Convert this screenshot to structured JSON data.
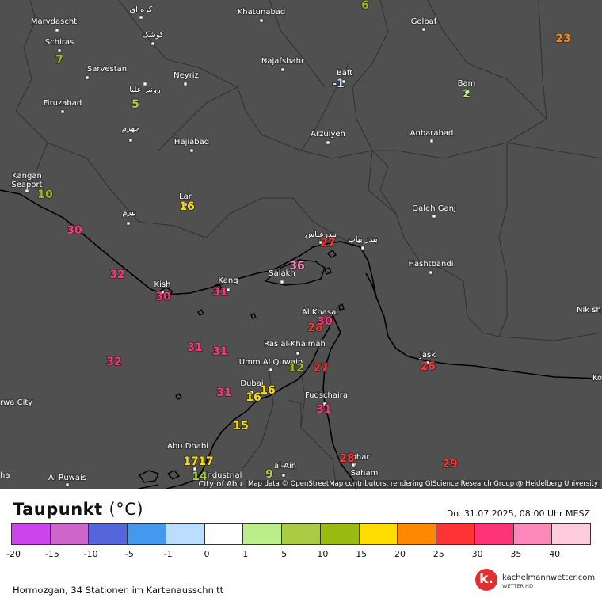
{
  "title": {
    "text": "Taupunkt",
    "unit": "(°C)"
  },
  "datetime": "Do. 31.07.2025, 08:00 Uhr MESZ",
  "attribution": "Map data © OpenStreetMap contributors, rendering GIScience Research Group @ Heidelberg University",
  "station_count": "Hormozgan, 34 Stationen im Kartenausschnitt",
  "logo": {
    "name": "kachelmannwetter.com",
    "sub": "WETTER HD",
    "letter": "k."
  },
  "colors": {
    "map_background": "#505050",
    "border": "#333333",
    "coast": "#000000",
    "label_text": "#ffffff"
  },
  "scale": {
    "ticks": [
      "-20",
      "-15",
      "-10",
      "-5",
      "-1",
      "0",
      "1",
      "5",
      "10",
      "15",
      "20",
      "25",
      "30",
      "35",
      "40"
    ],
    "colors": [
      "#cc44ee",
      "#cc66cc",
      "#5566dd",
      "#4499ee",
      "#bbddff",
      "#ffffff",
      "#bbee88",
      "#aacc44",
      "#99bb11",
      "#ffdd00",
      "#ff8800",
      "#ff3333",
      "#ff3377",
      "#ff88bb",
      "#ffccdd"
    ]
  },
  "places": [
    {
      "name": "Marvdascht"
    },
    {
      "name": "کره ای"
    },
    {
      "name": "Khatunabad"
    },
    {
      "name": "Golbaf"
    },
    {
      "name": "Schiras"
    },
    {
      "name": "کوشک"
    },
    {
      "name": "Sarvestan"
    },
    {
      "name": "Neyriz"
    },
    {
      "name": "Najafshahr"
    },
    {
      "name": "Baft"
    },
    {
      "name": "Bam"
    },
    {
      "name": "رونیز علیا"
    },
    {
      "name": "Firuzabad"
    },
    {
      "name": "جهرم"
    },
    {
      "name": "Hajiabad"
    },
    {
      "name": "Arzuiyeh"
    },
    {
      "name": "Anbarabad"
    },
    {
      "name": "Kangan Seaport"
    },
    {
      "name": "Lar"
    },
    {
      "name": "بیرم"
    },
    {
      "name": "Qaleh Ganj"
    },
    {
      "name": "بندرعباس"
    },
    {
      "name": "بندر بیاب"
    },
    {
      "name": "Hashtbandi"
    },
    {
      "name": "Kish"
    },
    {
      "name": "Kang"
    },
    {
      "name": "Salakh"
    },
    {
      "name": "Al Khasal"
    },
    {
      "name": "Nik sh"
    },
    {
      "name": "Ras al-Khaimah"
    },
    {
      "name": "Jask"
    },
    {
      "name": "Umm Al Quwain"
    },
    {
      "name": "Dubai"
    },
    {
      "name": "Fudschaira"
    },
    {
      "name": "Ko"
    },
    {
      "name": "rwa City"
    },
    {
      "name": "Abu Dhabi"
    },
    {
      "name": "al-Ain"
    },
    {
      "name": "Sohar"
    },
    {
      "name": "Al Ruwais"
    },
    {
      "name": "Industrial City of Abu"
    },
    {
      "name": "Saham"
    },
    {
      "name": "ha"
    }
  ],
  "stations": [
    {
      "value": "6",
      "color": "#99bb11"
    },
    {
      "value": "23",
      "color": "#ff8800"
    },
    {
      "value": "7",
      "color": "#99bb11"
    },
    {
      "value": "-1",
      "color": "#bbddff"
    },
    {
      "value": "2",
      "color": "#bbee88"
    },
    {
      "value": "5",
      "color": "#aacc44"
    },
    {
      "value": "10",
      "color": "#99bb11"
    },
    {
      "value": "16",
      "color": "#ffdd00"
    },
    {
      "value": "30",
      "color": "#ff3377"
    },
    {
      "value": "27",
      "color": "#ff3333"
    },
    {
      "value": "32",
      "color": "#ff3377"
    },
    {
      "value": "36",
      "color": "#ff88bb"
    },
    {
      "value": "30",
      "color": "#ff3377"
    },
    {
      "value": "31",
      "color": "#ff3377"
    },
    {
      "value": "28",
      "color": "#ff3333"
    },
    {
      "value": "30",
      "color": "#ff3377"
    },
    {
      "value": "31",
      "color": "#ff3377"
    },
    {
      "value": "31",
      "color": "#ff3377"
    },
    {
      "value": "32",
      "color": "#ff3377"
    },
    {
      "value": "12",
      "color": "#99bb11"
    },
    {
      "value": "27",
      "color": "#ff3333"
    },
    {
      "value": "26",
      "color": "#ff3333"
    },
    {
      "value": "31",
      "color": "#ff3377"
    },
    {
      "value": "16",
      "color": "#ffdd00"
    },
    {
      "value": "16",
      "color": "#ffdd00"
    },
    {
      "value": "31",
      "color": "#ff3377"
    },
    {
      "value": "15",
      "color": "#ffdd00"
    },
    {
      "value": "28",
      "color": "#ff3333"
    },
    {
      "value": "29",
      "color": "#ff3333"
    },
    {
      "value": "17",
      "color": "#ffdd00"
    },
    {
      "value": "17",
      "color": "#ffdd00"
    },
    {
      "value": "14",
      "color": "#aacc44"
    },
    {
      "value": "9",
      "color": "#aacc44"
    }
  ]
}
